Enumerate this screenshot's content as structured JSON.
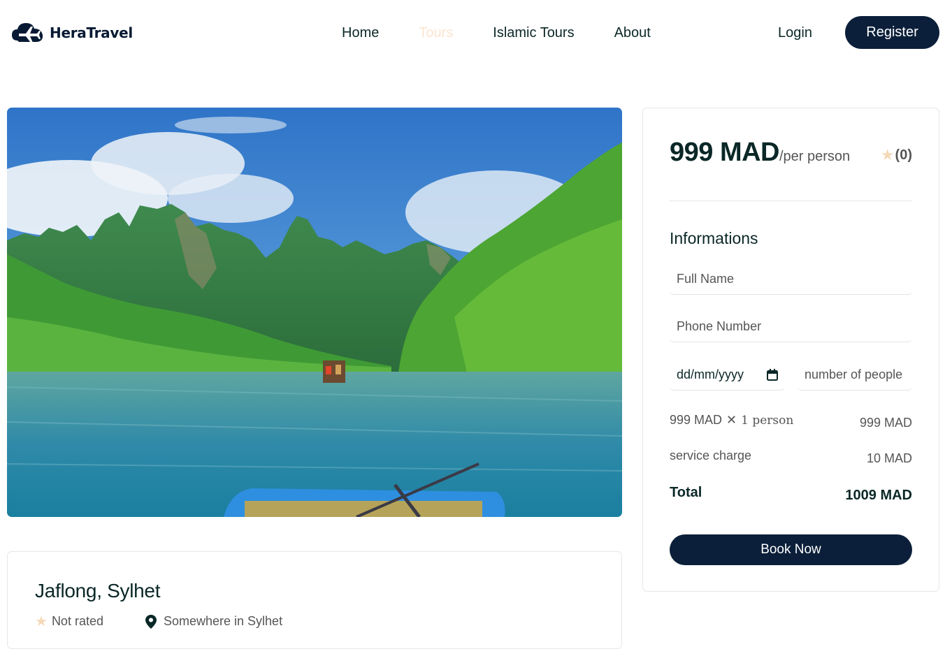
{
  "header": {
    "logo_text": "HeraTravel",
    "nav": [
      {
        "label": "Home",
        "active": false
      },
      {
        "label": "Tours",
        "active": true
      },
      {
        "label": "Islamic Tours",
        "active": false
      },
      {
        "label": "About",
        "active": false
      }
    ],
    "login_label": "Login",
    "register_label": "Register"
  },
  "tour": {
    "title": "Jaflong, Sylhet",
    "rating_text": "Not rated",
    "location": "Somewhere in Sylhet"
  },
  "booking": {
    "price": "999 MAD",
    "per_person": "/per person",
    "rating_count": "(0)",
    "informations_heading": "Informations",
    "full_name_placeholder": "Full Name",
    "phone_placeholder": "Phone Number",
    "date_placeholder": "dd/mm/yyyy",
    "people_placeholder": "number of people",
    "line_price": "999 MAD",
    "line_person": "1 person",
    "line_total": "999 MAD",
    "service_label": "service charge",
    "service_value": "10 MAD",
    "total_label": "Total",
    "total_value": "1009 MAD",
    "book_label": "Book Now"
  },
  "colors": {
    "primary": "#0b1f3a",
    "active_nav": "#fae5cf",
    "star": "#f4d9b8",
    "heading": "#0b2727"
  },
  "icons": [
    "logo-airplane-cloud-icon",
    "star-icon",
    "map-pin-icon",
    "calendar-icon",
    "close-x-icon"
  ]
}
